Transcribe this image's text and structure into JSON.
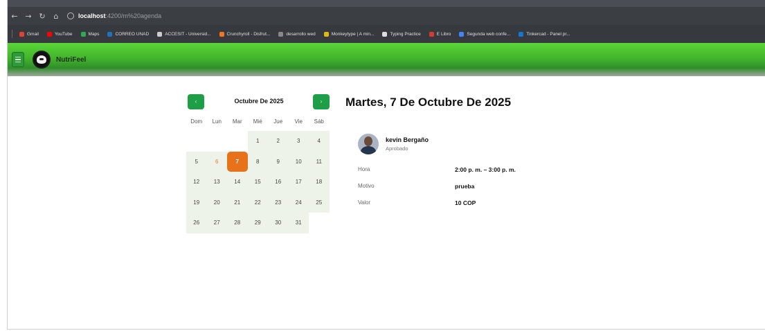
{
  "browser": {
    "url_host": "localhost",
    "url_path": ":4200/m%20agenda",
    "bookmarks": [
      {
        "label": "Gmail",
        "color": "#e44134"
      },
      {
        "label": "YouTube",
        "color": "#ff0000"
      },
      {
        "label": "Maps",
        "color": "#34a853"
      },
      {
        "label": "CORREO UNAD",
        "color": "#1e73be"
      },
      {
        "label": "ACCESIT - Universid...",
        "color": "#cccccc"
      },
      {
        "label": "Crunchyroll - Disfrut...",
        "color": "#f47521"
      },
      {
        "label": "desarrollo wed",
        "color": "#888888"
      },
      {
        "label": "Monkeytype | A min...",
        "color": "#e2b714"
      },
      {
        "label": "Typing Practice",
        "color": "#dddddd"
      },
      {
        "label": "E Libro",
        "color": "#d63b2f"
      },
      {
        "label": "Segunda web confe...",
        "color": "#4285f4"
      },
      {
        "label": "Tinkercad - Panel pr...",
        "color": "#1477d1"
      }
    ]
  },
  "app": {
    "brand": "NutriFeel",
    "accent": "#43b52b"
  },
  "calendar": {
    "month_title": "Octubre De 2025",
    "prev_label": "‹",
    "next_label": "›",
    "weekdays": [
      "Dom",
      "Lun",
      "Mar",
      "Mié",
      "Jue",
      "Vie",
      "Sáb"
    ],
    "first_weekday_index": 3,
    "days_in_month": 31,
    "today": 6,
    "selected": 7,
    "selected_color": "#e8721c"
  },
  "detail": {
    "date_title": "Martes, 7 De Octubre De 2025",
    "patient_name": "kevin Bergaño",
    "status": "Aprobado",
    "hora_label": "Hora",
    "hora_value": "2:00 p. m. – 3:00 p. m.",
    "motivo_label": "Motivo",
    "motivo_value": "prueba",
    "valor_label": "Valor",
    "valor_value": "10 COP"
  }
}
